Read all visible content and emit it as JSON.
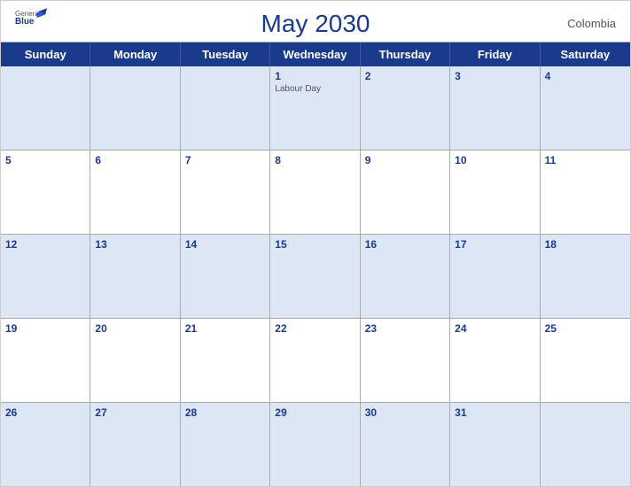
{
  "header": {
    "title": "May 2030",
    "country": "Colombia",
    "logo": {
      "general": "General",
      "blue": "Blue"
    }
  },
  "dayHeaders": [
    "Sunday",
    "Monday",
    "Tuesday",
    "Wednesday",
    "Thursday",
    "Friday",
    "Saturday"
  ],
  "weeks": [
    [
      {
        "day": "",
        "empty": true
      },
      {
        "day": "",
        "empty": true
      },
      {
        "day": "",
        "empty": true
      },
      {
        "day": "1",
        "event": "Labour Day"
      },
      {
        "day": "2"
      },
      {
        "day": "3"
      },
      {
        "day": "4"
      }
    ],
    [
      {
        "day": "5"
      },
      {
        "day": "6"
      },
      {
        "day": "7"
      },
      {
        "day": "8"
      },
      {
        "day": "9"
      },
      {
        "day": "10"
      },
      {
        "day": "11"
      }
    ],
    [
      {
        "day": "12"
      },
      {
        "day": "13"
      },
      {
        "day": "14"
      },
      {
        "day": "15"
      },
      {
        "day": "16"
      },
      {
        "day": "17"
      },
      {
        "day": "18"
      }
    ],
    [
      {
        "day": "19"
      },
      {
        "day": "20"
      },
      {
        "day": "21"
      },
      {
        "day": "22"
      },
      {
        "day": "23"
      },
      {
        "day": "24"
      },
      {
        "day": "25"
      }
    ],
    [
      {
        "day": "26"
      },
      {
        "day": "27"
      },
      {
        "day": "28"
      },
      {
        "day": "29"
      },
      {
        "day": "30"
      },
      {
        "day": "31"
      },
      {
        "day": "",
        "empty": true
      }
    ]
  ],
  "shadedRows": [
    0,
    2,
    4
  ],
  "colors": {
    "headerBg": "#1a3a8c",
    "shadedCell": "#dce6f5",
    "dayNumber": "#1a3a8c"
  }
}
